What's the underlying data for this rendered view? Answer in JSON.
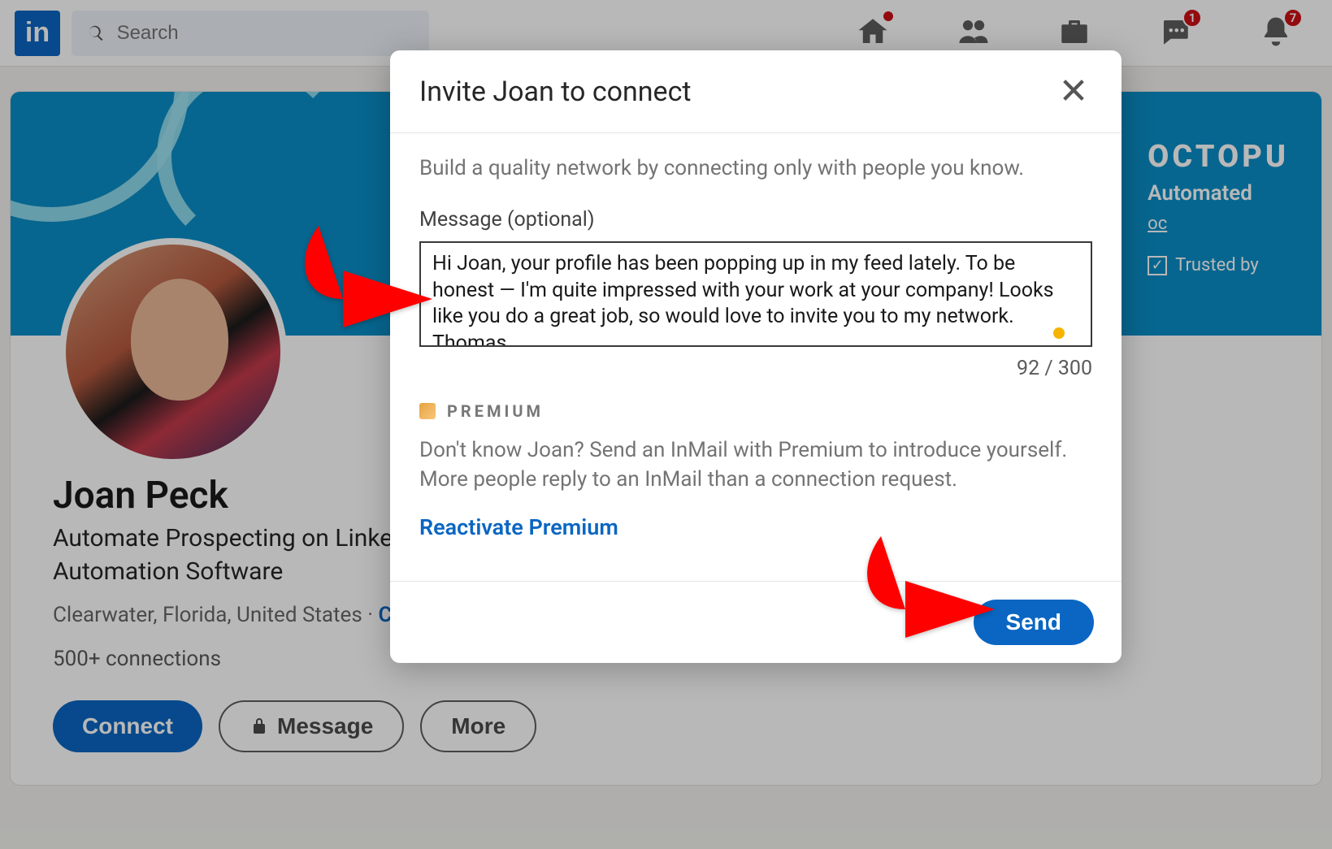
{
  "nav": {
    "search_placeholder": "Search",
    "home_badge": "",
    "msg_badge": "1",
    "notif_badge": "7"
  },
  "cover": {
    "brand": "OCTOPU",
    "subtitle": "Automated",
    "link_prefix": "oc",
    "trusted": "Trusted by"
  },
  "profile": {
    "name": "Joan Peck",
    "headline": "Automate Prospecting on LinkedIn wi Marketing Automation Software",
    "location": "Clearwater, Florida, United States · ",
    "contact_label": "Contact",
    "connections": "500+ connections",
    "connect_btn": "Connect",
    "message_btn": "Message",
    "more_btn": "More"
  },
  "modal": {
    "title": "Invite Joan to connect",
    "hint": "Build a quality network by connecting only with people you know.",
    "message_label": "Message (optional)",
    "message_value": "Hi Joan, your profile has been popping up in my feed lately. To be honest — I'm quite impressed with your work at your company! Looks like you do a great job, so would love to invite you to my network.\nThomas",
    "counter": "92 / 300",
    "premium_label": "PREMIUM",
    "premium_desc": "Don't know Joan? Send an InMail with Premium to introduce yourself. More people reply to an InMail than a connection request.",
    "reactivate": "Reactivate Premium",
    "send": "Send"
  }
}
